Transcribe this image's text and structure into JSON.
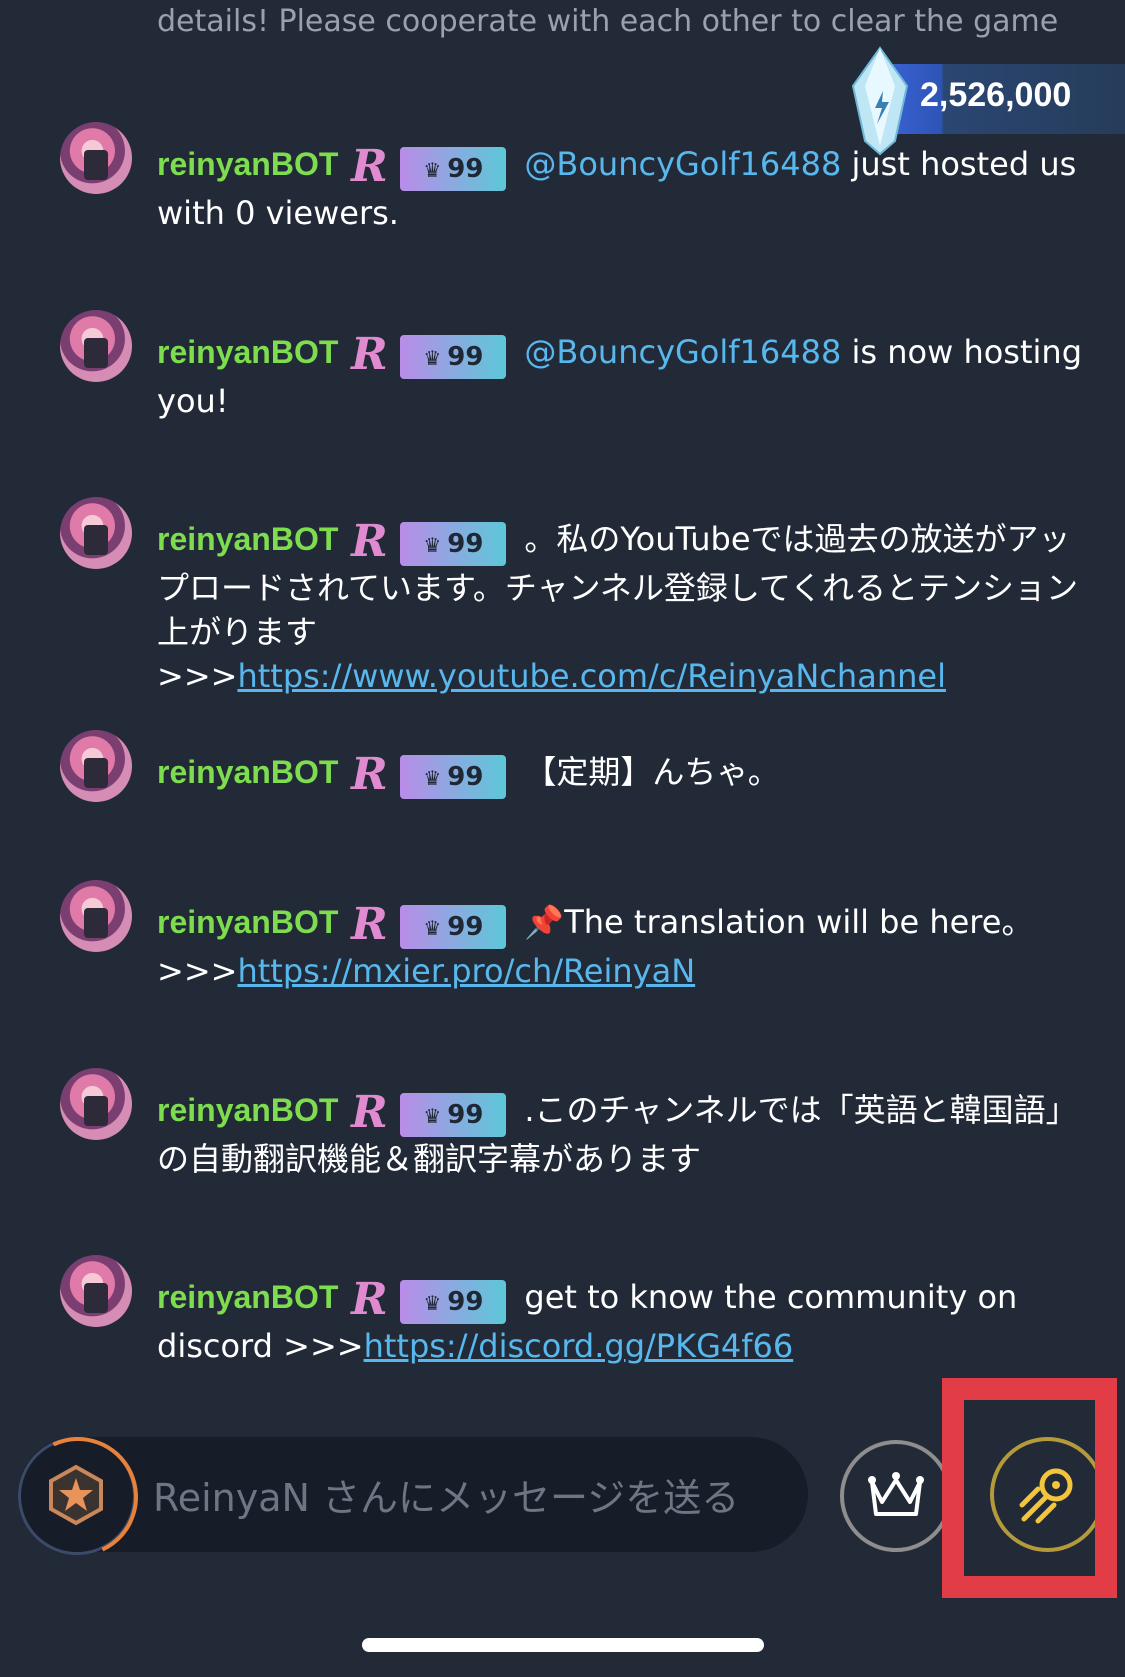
{
  "top_message": "details! Please cooperate with each other to clear the game",
  "gem_counter": {
    "value": "2,526,000",
    "icon": "crystal-icon"
  },
  "messages": [
    {
      "user": "reinyanBOT",
      "level": "99",
      "parts": [
        {
          "type": "mention",
          "text": "@BouncyGolf16488"
        },
        {
          "type": "text",
          "text": " just hosted us with 0 viewers."
        }
      ]
    },
    {
      "user": "reinyanBOT",
      "level": "99",
      "parts": [
        {
          "type": "mention",
          "text": "@BouncyGolf16488"
        },
        {
          "type": "text",
          "text": " is now hosting you!"
        }
      ]
    },
    {
      "user": "reinyanBOT",
      "level": "99",
      "parts": [
        {
          "type": "text",
          "text": "。私のYouTubeでは過去の放送がアップロードされています。チャンネル登録してくれるとテンション上がります>>>"
        },
        {
          "type": "link",
          "text": "https://www.youtube.com/c/ReinyaNchannel"
        }
      ]
    },
    {
      "user": "reinyanBOT",
      "level": "99",
      "parts": [
        {
          "type": "text",
          "text": "【定期】んちゃ。"
        }
      ]
    },
    {
      "user": "reinyanBOT",
      "level": "99",
      "parts": [
        {
          "type": "text",
          "text": "📌The translation will be here。>>>"
        },
        {
          "type": "link",
          "text": "https://mxier.pro/ch/ReinyaN"
        }
      ]
    },
    {
      "user": "reinyanBOT",
      "level": "99",
      "parts": [
        {
          "type": "text",
          "text": ".このチャンネルでは「英語と韓国語」の自動翻訳機能＆翻訳字幕があります"
        }
      ]
    },
    {
      "user": "reinyanBOT",
      "level": "99",
      "parts": [
        {
          "type": "text",
          "text": "get to know the community on discord >>>"
        },
        {
          "type": "link",
          "text": "https://discord.gg/PKG4f66"
        }
      ]
    }
  ],
  "input": {
    "placeholder": "ReinyaN さんにメッセージを送る"
  },
  "buttons": {
    "crown": "crown-icon",
    "boost": "comet-icon"
  },
  "colors": {
    "background": "#222a38",
    "username": "#7edc4f",
    "link": "#58b8ee",
    "highlight": "#e23d46"
  }
}
